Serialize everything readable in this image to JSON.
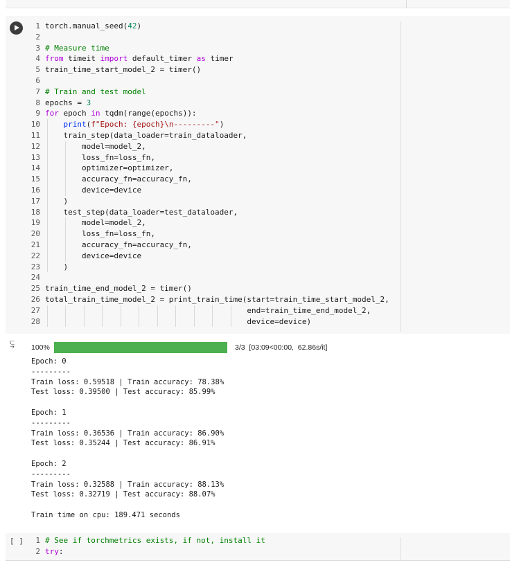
{
  "cell1": {
    "lines": [
      [
        [
          "fn",
          "torch.manual_seed("
        ],
        [
          "num",
          "42"
        ],
        [
          "fn",
          ")"
        ]
      ],
      [],
      [
        [
          "cm",
          "# Measure time"
        ]
      ],
      [
        [
          "kw",
          "from"
        ],
        [
          "fn",
          " timeit "
        ],
        [
          "kw",
          "import"
        ],
        [
          "fn",
          " default_timer "
        ],
        [
          "kw",
          "as"
        ],
        [
          "fn",
          " timer"
        ]
      ],
      [
        [
          "fn",
          "train_time_start_model_2 = timer()"
        ]
      ],
      [],
      [
        [
          "cm",
          "# Train and test model"
        ]
      ],
      [
        [
          "fn",
          "epochs = "
        ],
        [
          "num",
          "3"
        ]
      ],
      [
        [
          "kw",
          "for"
        ],
        [
          "fn",
          " epoch "
        ],
        [
          "kw",
          "in"
        ],
        [
          "fn",
          " tqdm(range(epochs)):"
        ]
      ],
      [
        [
          "fn",
          "    "
        ],
        [
          "pr",
          "print"
        ],
        [
          "fn",
          "("
        ],
        [
          "str",
          "f\"Epoch: {epoch}\\n---------\""
        ],
        [
          "fn",
          ")"
        ]
      ],
      [
        [
          "fn",
          "    train_step(data_loader=train_dataloader,"
        ]
      ],
      [
        [
          "fn",
          "        model=model_2,"
        ]
      ],
      [
        [
          "fn",
          "        loss_fn=loss_fn,"
        ]
      ],
      [
        [
          "fn",
          "        optimizer=optimizer,"
        ]
      ],
      [
        [
          "fn",
          "        accuracy_fn=accuracy_fn,"
        ]
      ],
      [
        [
          "fn",
          "        device=device"
        ]
      ],
      [
        [
          "fn",
          "    )"
        ]
      ],
      [
        [
          "fn",
          "    test_step(data_loader=test_dataloader,"
        ]
      ],
      [
        [
          "fn",
          "        model=model_2,"
        ]
      ],
      [
        [
          "fn",
          "        loss_fn=loss_fn,"
        ]
      ],
      [
        [
          "fn",
          "        accuracy_fn=accuracy_fn,"
        ]
      ],
      [
        [
          "fn",
          "        device=device"
        ]
      ],
      [
        [
          "fn",
          "    )"
        ]
      ],
      [],
      [
        [
          "fn",
          "train_time_end_model_2 = timer()"
        ]
      ],
      [
        [
          "fn",
          "total_train_time_model_2 = print_train_time(start=train_time_start_model_2,"
        ]
      ],
      [
        [
          "fn",
          "                                            end=train_time_end_model_2,"
        ]
      ],
      [
        [
          "fn",
          "                                            device=device)"
        ]
      ]
    ]
  },
  "output": {
    "progress": {
      "percent_label": "100%",
      "fraction": 1.0,
      "info": "3/3  [03:09<00:00,  62.86s/it]"
    },
    "lines": [
      "Epoch: 0",
      "---------",
      "Train loss: 0.59518 | Train accuracy: 78.38%",
      "Test loss: 0.39500 | Test accuracy: 85.99%",
      "",
      "Epoch: 1",
      "---------",
      "Train loss: 0.36536 | Train accuracy: 86.90%",
      "Test loss: 0.35244 | Test accuracy: 86.91%",
      "",
      "Epoch: 2",
      "---------",
      "Train loss: 0.32588 | Train accuracy: 88.13%",
      "Test loss: 0.32719 | Test accuracy: 88.07%",
      "",
      "Train time on cpu: 189.471 seconds"
    ]
  },
  "cell2": {
    "bracket": "[ ]",
    "lines": [
      [
        [
          "cm",
          "# See if torchmetrics exists, if not, install it"
        ]
      ],
      [
        [
          "kw",
          "try"
        ],
        [
          "fn",
          ":"
        ]
      ]
    ]
  },
  "icons": {
    "run": "play-icon",
    "output": "output-toggle-icon"
  },
  "colors": {
    "progress_fill": "#4caf50",
    "keyword": "#af00db",
    "comment": "#008000",
    "number": "#098658",
    "string": "#a31515"
  }
}
